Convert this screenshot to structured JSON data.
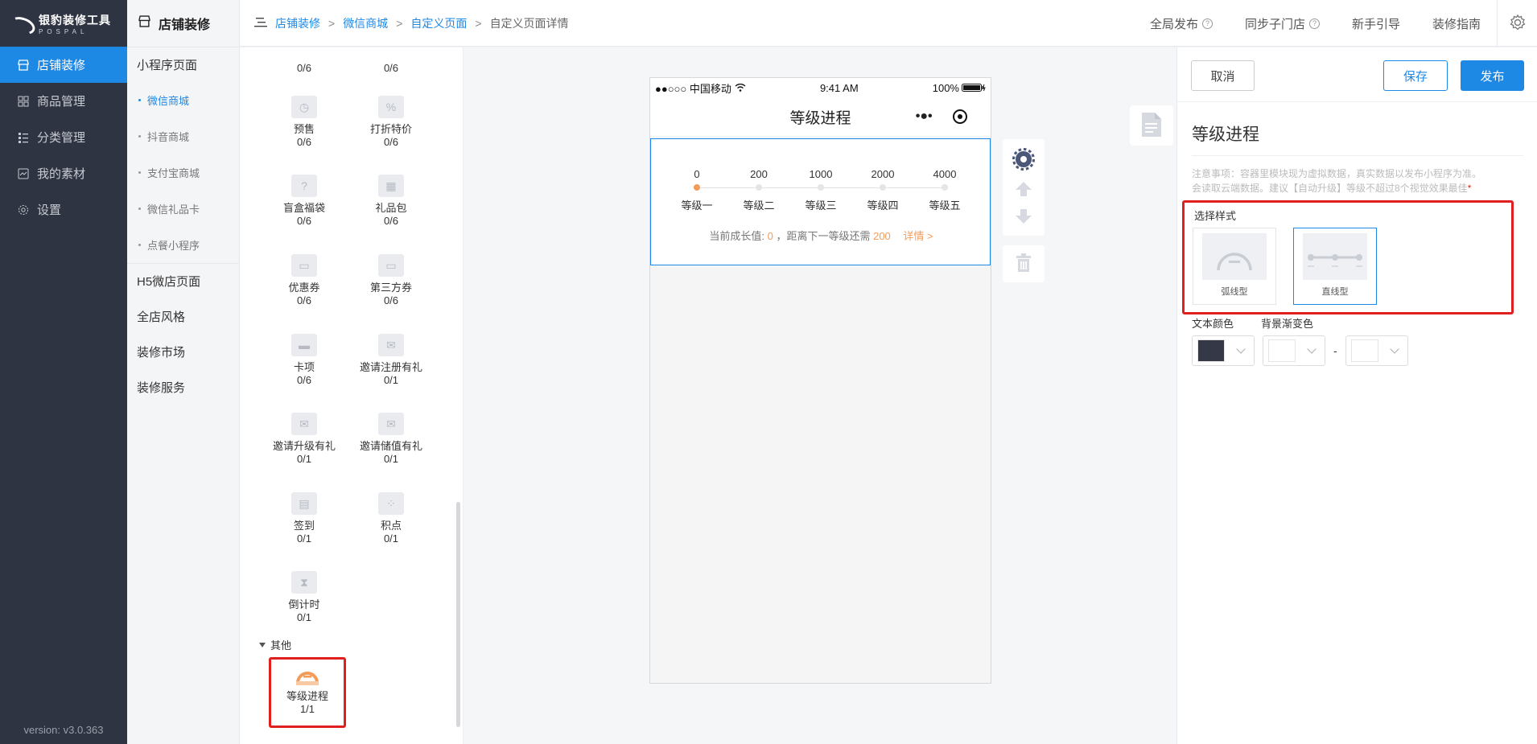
{
  "app": {
    "logo_title": "银豹装修工具",
    "logo_sub": "POSPAL",
    "version": "version: v3.0.363"
  },
  "sidebar": {
    "items": [
      {
        "label": "店铺装修",
        "icon": "store-icon",
        "active": true
      },
      {
        "label": "商品管理",
        "icon": "grid-icon",
        "active": false
      },
      {
        "label": "分类管理",
        "icon": "list-icon",
        "active": false
      },
      {
        "label": "我的素材",
        "icon": "image-icon",
        "active": false
      },
      {
        "label": "设置",
        "icon": "gear-icon",
        "active": false
      }
    ]
  },
  "subnav": {
    "title": "店铺装修",
    "group_mini": "小程序页面",
    "items": [
      "微信商城",
      "抖音商城",
      "支付宝商城",
      "微信礼品卡",
      "点餐小程序"
    ],
    "group_h5": "H5微店页面",
    "group_style": "全店风格",
    "group_market": "装修市场",
    "group_service": "装修服务"
  },
  "breadcrumb": {
    "items": [
      "店铺装修",
      "微信商城",
      "自定义页面"
    ],
    "current": "自定义页面详情",
    "sep": ">"
  },
  "top_actions": {
    "publish_all": "全局发布",
    "sync_store": "同步子门店",
    "guide": "新手引导",
    "decor_guide": "装修指南"
  },
  "components": {
    "top_counts": [
      "0/6",
      "0/6"
    ],
    "items": [
      {
        "name": "预售",
        "count": "0/6",
        "icon": "clock-icon"
      },
      {
        "name": "打折特价",
        "count": "0/6",
        "icon": "discount-tag-icon"
      },
      {
        "name": "盲盒福袋",
        "count": "0/6",
        "icon": "mystery-box-icon"
      },
      {
        "name": "礼品包",
        "count": "0/6",
        "icon": "gift-icon"
      },
      {
        "name": "优惠券",
        "count": "0/6",
        "icon": "coupon-icon"
      },
      {
        "name": "第三方券",
        "count": "0/6",
        "icon": "third-party-coupon-icon"
      },
      {
        "name": "卡项",
        "count": "0/6",
        "icon": "card-icon"
      },
      {
        "name": "邀请注册有礼",
        "count": "0/1",
        "icon": "envelope-icon"
      },
      {
        "name": "邀请升级有礼",
        "count": "0/1",
        "icon": "envelope-icon"
      },
      {
        "name": "邀请储值有礼",
        "count": "0/1",
        "icon": "envelope-icon"
      },
      {
        "name": "签到",
        "count": "0/1",
        "icon": "calendar-icon"
      },
      {
        "name": "积点",
        "count": "0/1",
        "icon": "points-icon"
      },
      {
        "name": "倒计时",
        "count": "0/1",
        "icon": "hourglass-icon"
      }
    ],
    "other_section": "其他",
    "level_progress": {
      "name": "等级进程",
      "count": "1/1",
      "icon": "level-gauge-icon"
    }
  },
  "phone": {
    "carrier": "●●○○○ 中国移动",
    "time": "9:41 AM",
    "battery": "100%",
    "title": "等级进程",
    "menu_dots": "•●•",
    "levels": [
      {
        "value": "0",
        "name": "等级一",
        "active": true
      },
      {
        "value": "200",
        "name": "等级二",
        "active": false
      },
      {
        "value": "1000",
        "name": "等级三",
        "active": false
      },
      {
        "value": "2000",
        "name": "等级四",
        "active": false
      },
      {
        "value": "4000",
        "name": "等级五",
        "active": false
      }
    ],
    "growth_prefix": "当前成长值:",
    "growth_value": "0",
    "growth_mid": "，距离下一等级还需",
    "growth_need": "200",
    "detail_link": "详情 >"
  },
  "panel": {
    "cancel": "取消",
    "save": "保存",
    "publish": "发布",
    "title": "等级进程",
    "notice_line1": "注意事项：容器里模块现为虚拟数据，真实数据以发布小程序为准。",
    "notice_line2": "会读取云端数据。建议【自动升级】等级不超过8个视觉效果最佳",
    "notice_star": "*",
    "style_label": "选择样式",
    "style_options": [
      {
        "label": "弧线型",
        "selected": false
      },
      {
        "label": "直线型",
        "selected": true
      }
    ],
    "text_color_label": "文本颜色",
    "bg_gradient_label": "背景渐变色",
    "dash": "-",
    "text_color": "#343847",
    "bg_color_start": "#ffffff",
    "bg_color_end": "#ffffff"
  },
  "colors": {
    "accent": "#1e88e5",
    "highlight": "#e02020",
    "orange": "#f39c5a",
    "sidebar_bg": "#2f3442"
  }
}
